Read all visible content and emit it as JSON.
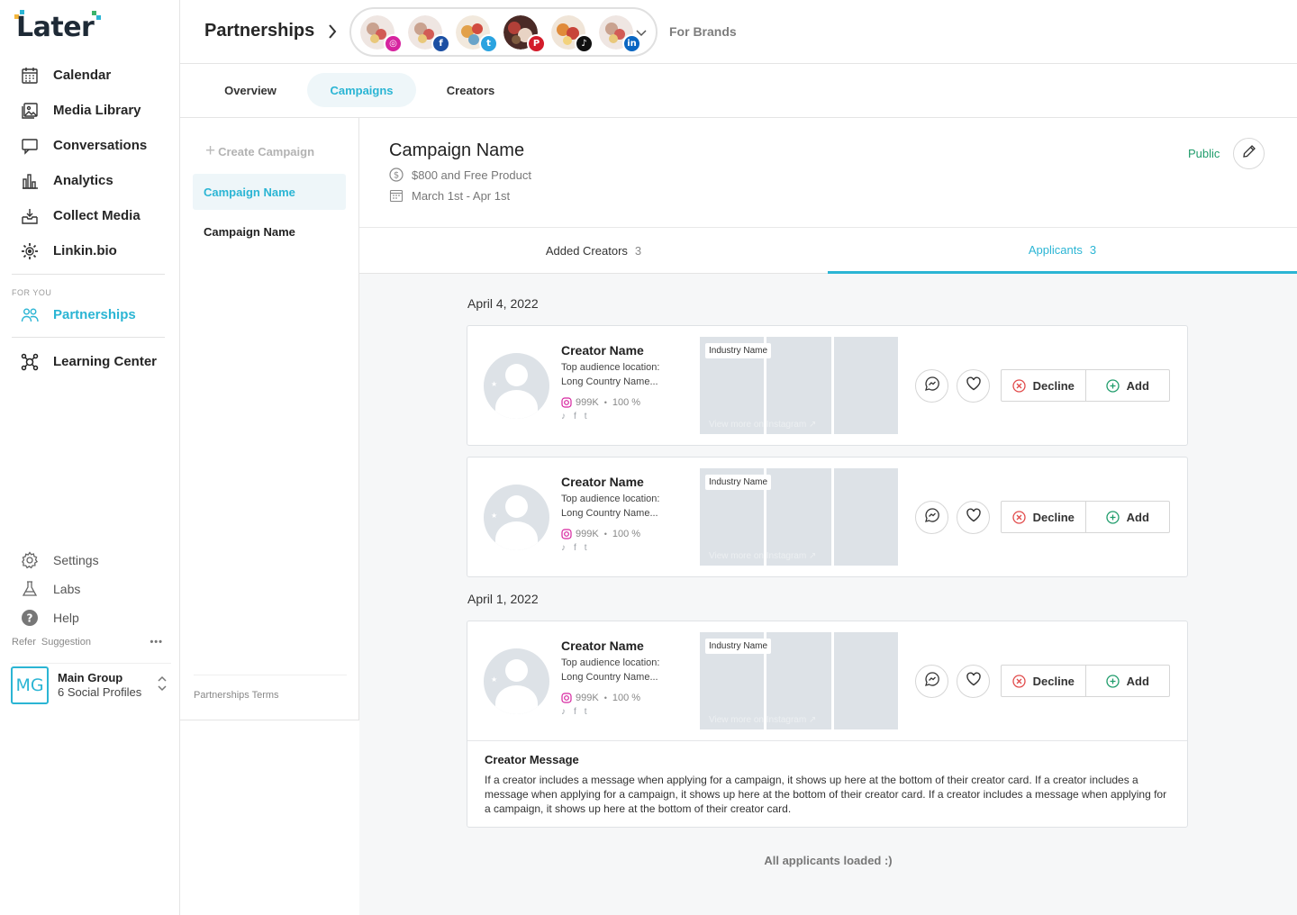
{
  "brand": {
    "logo_text": "Later"
  },
  "sidebar": {
    "items": [
      {
        "label": "Calendar",
        "icon": "calendar-icon"
      },
      {
        "label": "Media Library",
        "icon": "image-icon"
      },
      {
        "label": "Conversations",
        "icon": "chat-icon"
      },
      {
        "label": "Analytics",
        "icon": "bar-chart-icon"
      },
      {
        "label": "Collect Media",
        "icon": "download-tray-icon"
      },
      {
        "label": "Linkin.bio",
        "icon": "link-gear-icon"
      }
    ],
    "for_you_label": "FOR YOU",
    "partnerships_label": "Partnerships",
    "learning_label": "Learning Center",
    "bottom_items": [
      {
        "label": "Settings",
        "icon": "gear-icon"
      },
      {
        "label": "Labs",
        "icon": "flask-icon"
      },
      {
        "label": "Help",
        "icon": "help-icon"
      }
    ],
    "refer_label": "Refer",
    "suggestion_label": "Suggestion",
    "more_label": "•••",
    "account": {
      "initials": "MG",
      "name": "Main Group",
      "sub": "6 Social Profiles"
    }
  },
  "header": {
    "title": "Partnerships",
    "for_brands": "For Brands",
    "profiles": [
      {
        "network": "instagram",
        "badge": "◎",
        "color": "#d6249f"
      },
      {
        "network": "facebook",
        "badge": "f",
        "color": "#1b4fa3"
      },
      {
        "network": "twitter",
        "badge": "t",
        "color": "#2aa3e0"
      },
      {
        "network": "pinterest",
        "badge": "P",
        "color": "#d31c2b"
      },
      {
        "network": "tiktok",
        "badge": "♪",
        "color": "#111111"
      },
      {
        "network": "linkedin",
        "badge": "in",
        "color": "#0a66c2"
      }
    ]
  },
  "tabs": [
    {
      "label": "Overview"
    },
    {
      "label": "Campaigns"
    },
    {
      "label": "Creators"
    }
  ],
  "campaigns": {
    "create_label": "Create Campaign",
    "items": [
      {
        "label": "Campaign Name"
      },
      {
        "label": "Campaign Name"
      }
    ],
    "terms_label": "Partnerships Terms"
  },
  "campaign": {
    "title": "Campaign Name",
    "compensation": "$800 and Free Product",
    "dates": "March 1st - Apr 1st",
    "visibility": "Public"
  },
  "subtabs": [
    {
      "label": "Added Creators",
      "count": "3"
    },
    {
      "label": "Applicants",
      "count": "3"
    }
  ],
  "applicants": {
    "dates": [
      "April 4, 2022",
      "April 1, 2022"
    ],
    "cards": [
      {
        "name": "Creator Name",
        "loc_label": "Top audience location:",
        "loc_value": "Long Country Name...",
        "followers": "999K",
        "match": "100 %",
        "industry": "Industry Name",
        "view_more": "View more on Instagram ↗",
        "decline": "Decline",
        "add": "Add"
      },
      {
        "name": "Creator Name",
        "loc_label": "Top audience location:",
        "loc_value": "Long Country Name...",
        "followers": "999K",
        "match": "100 %",
        "industry": "Industry Name",
        "view_more": "View more on Instagram ↗",
        "decline": "Decline",
        "add": "Add"
      },
      {
        "name": "Creator Name",
        "loc_label": "Top audience location:",
        "loc_value": "Long Country Name...",
        "followers": "999K",
        "match": "100 %",
        "industry": "Industry Name",
        "view_more": "View more on Instagram ↗",
        "decline": "Decline",
        "add": "Add",
        "message_title": "Creator Message",
        "message": "If a creator includes a message when applying for a campaign, it shows up here at the bottom of their creator card. If a creator includes a message when applying for a campaign, it shows up here at the bottom of their creator card. If a creator includes a message when applying for a campaign, it shows up here at the bottom of their creator card."
      }
    ],
    "all_loaded": "All applicants loaded :)"
  },
  "colors": {
    "accent": "#2bb5d4",
    "public_green": "#1f9c6b",
    "decline_red": "#e14b4b",
    "add_green": "#1f9c6b"
  }
}
